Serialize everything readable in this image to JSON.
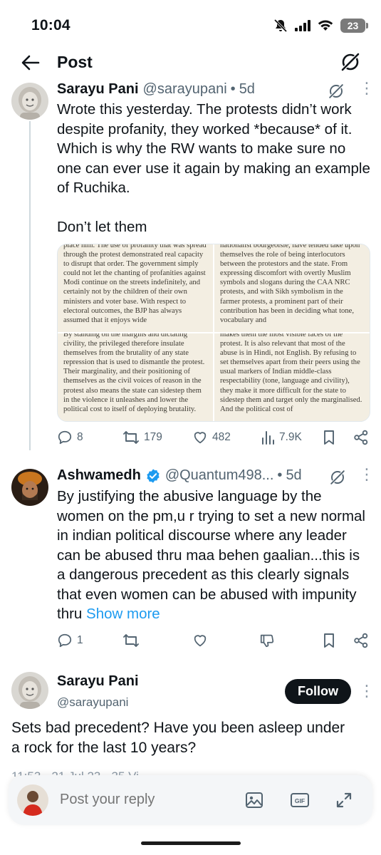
{
  "status_bar": {
    "time": "10:04",
    "battery": "23"
  },
  "header": {
    "title": "Post"
  },
  "main_post": {
    "name": "Sarayu Pani",
    "handle": "@sarayupani",
    "separator": "•",
    "time": "5d",
    "text": "Wrote this yesterday. The protests didn’t work despite profanity, they worked *because* of it. Which is why the RW wants to make sure no one can ever use it again by making an example of Ruchika.\n\nDon’t let them",
    "images": {
      "top_left": "place him. The use of profanity that was spread through the protest demonstrated real capacity to disrupt that order. The government simply could not let the chanting of profanities against Modi continue on the streets indefinitely, and certainly not by the children of their own ministers and voter base. With respect to electoral outcomes, the BJP has always assumed that it enjoys wide",
      "top_right": "nationalist bourgeoisie, have tended take upon themselves the role of being interlocutors between the protestors and the state. From expressing discomfort with overtly Muslim symbols and slogans during the CAA NRC protests, and with Sikh symbolism in the farmer protests, a prominent part of their contribution has been in deciding what tone, vocabulary and",
      "bottom_left": "By standing on the margins and dictating civility, the privileged therefore insulate themselves from the brutality of any state repression that is used to dismantle the protest. Their marginality, and their positioning of themselves as the civil voices of reason in the protest also means the state can sidestep them in the violence it unleashes and lower the political cost to itself of deploying brutality.",
      "bottom_right": "makes them the most visible faces of the protest. It is also relevant that most of the abuse is in Hindi, not English. By refusing to set themselves apart from their peers using the usual markers of Indian middle-class respectability (tone, language and civility), they make it more difficult for the state to sidestep them and target only the marginalised. And the political cost of"
    },
    "actions": {
      "replies": "8",
      "reposts": "179",
      "likes": "482",
      "views": "7.9K"
    }
  },
  "reply_post": {
    "name": "Ashwamedh",
    "handle": "@Quantum498...",
    "separator": "•",
    "time": "5d",
    "text": "By justifying the abusive language by the women on the pm,u r trying to set a new normal in indian political discourse where any leader can be abused thru maa behen gaalian...this is a dangerous precedent as this clearly signals that even women can be abused with impunity thru ",
    "show_more": "Show more",
    "actions": {
      "replies": "1"
    }
  },
  "focused_post": {
    "name": "Sarayu Pani",
    "handle": "@sarayupani",
    "follow_label": "Follow",
    "text": "Sets bad precedent? Have you been asleep under a rock for the last 10 years?",
    "meta_partial": "11:53 · 21 Jul 23 · 35 Vi"
  },
  "composer": {
    "placeholder": "Post your reply"
  }
}
